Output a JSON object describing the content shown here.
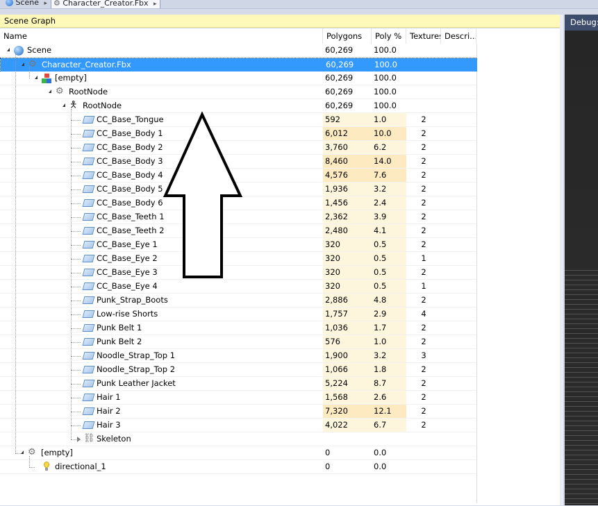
{
  "breadcrumb": [
    "Scene",
    "Character_Creator.Fbx"
  ],
  "panel": {
    "title": "Scene Graph",
    "columns": [
      "Name",
      "Polygons",
      "Poly %",
      "Textures",
      "Descri..."
    ]
  },
  "debug_label": "Debug:",
  "rows": [
    {
      "name": "Scene",
      "polygons": "60,269",
      "poly_pct": "100.0",
      "textures": "",
      "icon": "scene-globe-icon"
    },
    {
      "name": "Character_Creator.Fbx",
      "polygons": "60,269",
      "poly_pct": "100.0",
      "textures": "",
      "icon": "gear-node-icon",
      "selected": true
    },
    {
      "name": "[empty]",
      "polygons": "60,269",
      "poly_pct": "100.0",
      "textures": "",
      "icon": "cubes-icon"
    },
    {
      "name": "RootNode",
      "polygons": "60,269",
      "poly_pct": "100.0",
      "textures": "",
      "icon": "gear-node-icon"
    },
    {
      "name": "RootNode",
      "polygons": "60,269",
      "poly_pct": "100.0",
      "textures": "",
      "icon": "bone-figure-icon"
    },
    {
      "name": "CC_Base_Tongue",
      "polygons": "592",
      "poly_pct": "1.0",
      "textures": "2",
      "icon": "mesh-icon"
    },
    {
      "name": "CC_Base_Body 1",
      "polygons": "6,012",
      "poly_pct": "10.0",
      "textures": "2",
      "icon": "mesh-icon"
    },
    {
      "name": "CC_Base_Body 2",
      "polygons": "3,760",
      "poly_pct": "6.2",
      "textures": "2",
      "icon": "mesh-icon"
    },
    {
      "name": "CC_Base_Body 3",
      "polygons": "8,460",
      "poly_pct": "14.0",
      "textures": "2",
      "icon": "mesh-icon"
    },
    {
      "name": "CC_Base_Body 4",
      "polygons": "4,576",
      "poly_pct": "7.6",
      "textures": "2",
      "icon": "mesh-icon"
    },
    {
      "name": "CC_Base_Body 5",
      "polygons": "1,936",
      "poly_pct": "3.2",
      "textures": "2",
      "icon": "mesh-icon"
    },
    {
      "name": "CC_Base_Body 6",
      "polygons": "1,456",
      "poly_pct": "2.4",
      "textures": "2",
      "icon": "mesh-icon"
    },
    {
      "name": "CC_Base_Teeth 1",
      "polygons": "2,362",
      "poly_pct": "3.9",
      "textures": "2",
      "icon": "mesh-icon"
    },
    {
      "name": "CC_Base_Teeth 2",
      "polygons": "2,480",
      "poly_pct": "4.1",
      "textures": "2",
      "icon": "mesh-icon"
    },
    {
      "name": "CC_Base_Eye 1",
      "polygons": "320",
      "poly_pct": "0.5",
      "textures": "2",
      "icon": "mesh-icon"
    },
    {
      "name": "CC_Base_Eye 2",
      "polygons": "320",
      "poly_pct": "0.5",
      "textures": "1",
      "icon": "mesh-icon"
    },
    {
      "name": "CC_Base_Eye 3",
      "polygons": "320",
      "poly_pct": "0.5",
      "textures": "2",
      "icon": "mesh-icon"
    },
    {
      "name": "CC_Base_Eye 4",
      "polygons": "320",
      "poly_pct": "0.5",
      "textures": "1",
      "icon": "mesh-icon"
    },
    {
      "name": "Punk_Strap_Boots",
      "polygons": "2,886",
      "poly_pct": "4.8",
      "textures": "2",
      "icon": "mesh-icon"
    },
    {
      "name": "Low-rise Shorts",
      "polygons": "1,757",
      "poly_pct": "2.9",
      "textures": "4",
      "icon": "mesh-icon"
    },
    {
      "name": "Punk Belt 1",
      "polygons": "1,036",
      "poly_pct": "1.7",
      "textures": "2",
      "icon": "mesh-icon"
    },
    {
      "name": "Punk Belt 2",
      "polygons": "576",
      "poly_pct": "1.0",
      "textures": "2",
      "icon": "mesh-icon"
    },
    {
      "name": "Noodle_Strap_Top 1",
      "polygons": "1,900",
      "poly_pct": "3.2",
      "textures": "3",
      "icon": "mesh-icon"
    },
    {
      "name": "Noodle_Strap_Top 2",
      "polygons": "1,066",
      "poly_pct": "1.8",
      "textures": "2",
      "icon": "mesh-icon"
    },
    {
      "name": "Punk Leather Jacket",
      "polygons": "5,224",
      "poly_pct": "8.7",
      "textures": "2",
      "icon": "mesh-icon"
    },
    {
      "name": "Hair 1",
      "polygons": "1,568",
      "poly_pct": "2.6",
      "textures": "2",
      "icon": "mesh-icon"
    },
    {
      "name": "Hair 2",
      "polygons": "7,320",
      "poly_pct": "12.1",
      "textures": "2",
      "icon": "mesh-icon"
    },
    {
      "name": "Hair 3",
      "polygons": "4,022",
      "poly_pct": "6.7",
      "textures": "2",
      "icon": "mesh-icon"
    },
    {
      "name": "Skeleton",
      "polygons": "",
      "poly_pct": "",
      "textures": "",
      "icon": "chain-link-icon"
    },
    {
      "name": "[empty]",
      "polygons": "0",
      "poly_pct": "0.0",
      "textures": "",
      "icon": "gear-node-icon"
    },
    {
      "name": "directional_1",
      "polygons": "0",
      "poly_pct": "0.0",
      "textures": "",
      "icon": "light-bulb-icon"
    }
  ],
  "colors": {
    "selection": "#3399ff",
    "panel_title_bg": "#fef8b9",
    "cell_highlight": "#fef6dc",
    "debug_header": "#3e4d6b"
  }
}
